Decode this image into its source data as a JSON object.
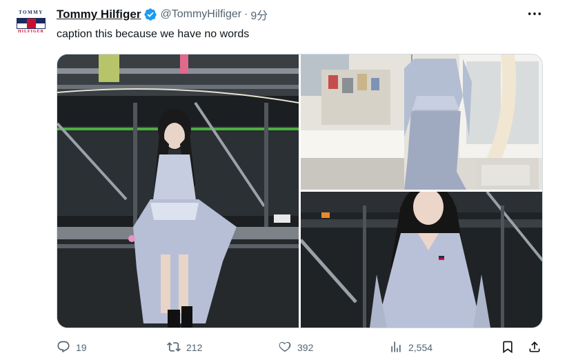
{
  "account": {
    "display_name": "Tommy Hilfiger",
    "handle": "@TommyHilfiger",
    "separator": "·",
    "time": "9分",
    "logo_top": "TOMMY",
    "logo_bottom": "HILFIGER",
    "verified_icon": "verified-badge-icon"
  },
  "tweet": {
    "text": "caption this because we have no words"
  },
  "media": {
    "photos": [
      "photo-backstage-full",
      "photo-dress-mannequin",
      "photo-backstage-closeup"
    ],
    "count": 3
  },
  "actions": {
    "reply_count": "19",
    "retweet_count": "212",
    "like_count": "392",
    "views_count": "2,554"
  },
  "colors": {
    "text_primary": "#0f1419",
    "text_secondary": "#536471",
    "verified_blue": "#1d9bf0",
    "brand_navy": "#1b2a5c",
    "brand_red": "#c8102e"
  }
}
